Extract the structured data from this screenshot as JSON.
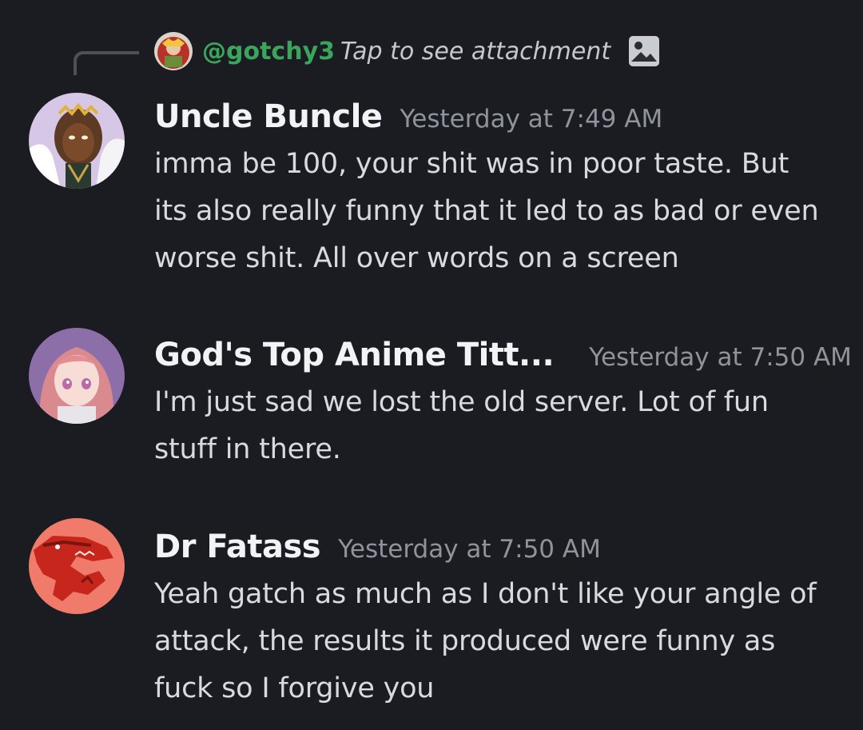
{
  "reply": {
    "username": "@gotchy3",
    "text": "Tap to see attachment",
    "icon": "image-icon"
  },
  "messages": [
    {
      "username": "Uncle Buncle",
      "timestamp": "Yesterday at 7:49 AM",
      "lines": [
        "imma be 100, your shit was in poor taste. But",
        "its also really funny that it led to as bad or even",
        "worse shit. All over words on a screen"
      ]
    },
    {
      "username": "God's Top Anime Titt...",
      "timestamp": "Yesterday at 7:50 AM",
      "lines": [
        "I'm just sad we lost the old server. Lot of fun",
        "stuff in there."
      ]
    },
    {
      "username": "Dr Fatass",
      "timestamp": "Yesterday at 7:50 AM",
      "lines": [
        "Yeah gatch as much as I don't like your angle of",
        "attack, the results it produced were funny as",
        "fuck so I forgive you"
      ]
    }
  ],
  "colors": {
    "background": "#1b1c21",
    "reply_username": "#3ba55c",
    "username": "#f2f3f5",
    "timestamp": "#8f939b",
    "message_text": "#d8dadf"
  }
}
